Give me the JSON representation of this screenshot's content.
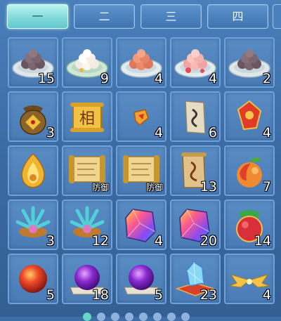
{
  "tabs": [
    {
      "label": "一",
      "active": true
    },
    {
      "label": "二",
      "active": false
    },
    {
      "label": "三",
      "active": false
    },
    {
      "label": "四",
      "active": false
    }
  ],
  "inventory": {
    "rows": [
      [
        {
          "icon": "dark-dumpling-plate-icon",
          "count": "15"
        },
        {
          "icon": "white-dumpling-plate-icon",
          "count": "9"
        },
        {
          "icon": "red-dumpling-plate-icon",
          "count": "4"
        },
        {
          "icon": "flower-dumpling-plate-icon",
          "count": "4"
        },
        {
          "icon": "dark-dumpling-plate-icon",
          "count": "2"
        }
      ],
      [
        {
          "icon": "treasure-pouch-icon",
          "count": "3"
        },
        {
          "icon": "xiang-scroll-icon",
          "count": ""
        },
        {
          "icon": "paper-fragment-icon",
          "count": "4"
        },
        {
          "icon": "talisman-paper-icon",
          "count": "6"
        },
        {
          "icon": "red-charm-icon",
          "count": "4"
        }
      ],
      [
        {
          "icon": "golden-flame-icon",
          "count": ""
        },
        {
          "icon": "defense-scroll-icon",
          "count": "",
          "tag": "防御"
        },
        {
          "icon": "defense-scroll-icon",
          "count": "",
          "tag": "防御"
        },
        {
          "icon": "rune-scroll-icon",
          "count": "13"
        },
        {
          "icon": "peach-icon",
          "count": "7"
        }
      ],
      [
        {
          "icon": "crystal-cluster-icon",
          "count": "3"
        },
        {
          "icon": "crystal-cluster-icon",
          "count": "12"
        },
        {
          "icon": "rainbow-gem-icon",
          "count": "4"
        },
        {
          "icon": "rainbow-gem-icon",
          "count": "20"
        },
        {
          "icon": "jade-fruit-icon",
          "count": "14"
        }
      ],
      [
        {
          "icon": "red-orb-icon",
          "count": "5"
        },
        {
          "icon": "purple-orb-icon",
          "count": "18"
        },
        {
          "icon": "purple-orb-icon",
          "count": "5"
        },
        {
          "icon": "ice-crystal-cushion-icon",
          "count": "23"
        },
        {
          "icon": "golden-wings-icon",
          "count": "4"
        }
      ]
    ]
  },
  "pagination": {
    "total": 8,
    "current": 1
  },
  "colors": {
    "active_tab": "#7fd8d9",
    "panel": "#4a7bb5",
    "slot_border": "#6fa2d6"
  }
}
